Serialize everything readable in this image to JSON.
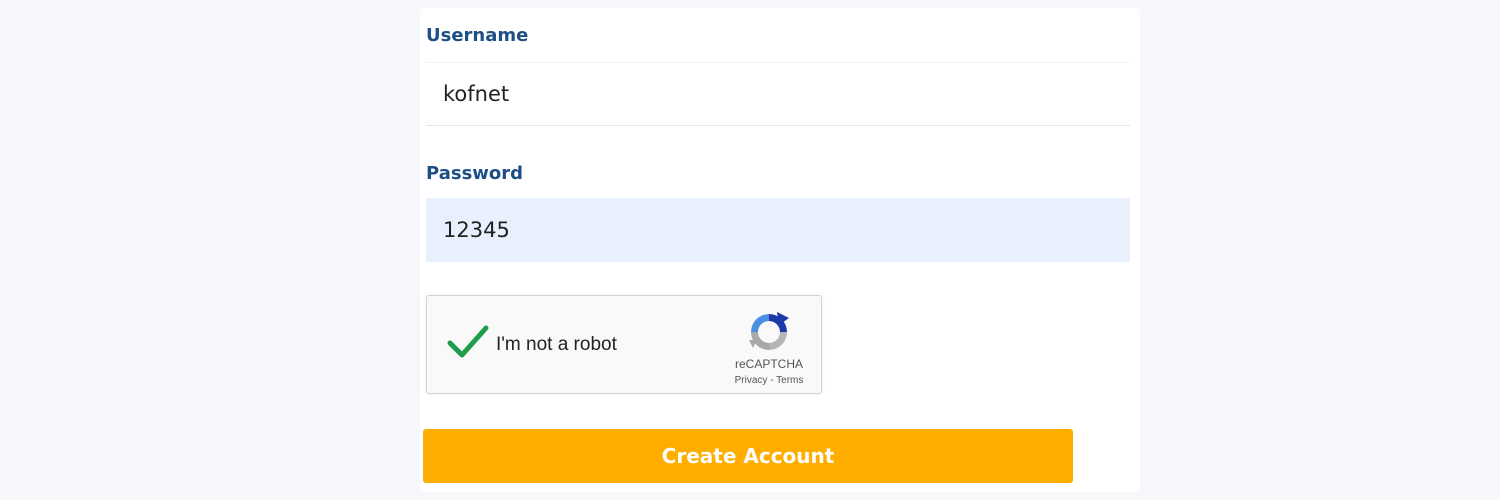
{
  "form": {
    "username": {
      "label": "Username",
      "value": "kofnet"
    },
    "password": {
      "label": "Password",
      "value": "12345"
    },
    "captcha": {
      "label": "I'm not a robot",
      "checked": true,
      "brand": "reCAPTCHA",
      "privacy_link": "Privacy",
      "separator": "-",
      "terms_link": "Terms"
    },
    "submit_label": "Create Account"
  },
  "colors": {
    "label": "#1d4f86",
    "password_fill": "#e8f0fe",
    "button": "#ffae00",
    "check": "#1e9e4a"
  }
}
